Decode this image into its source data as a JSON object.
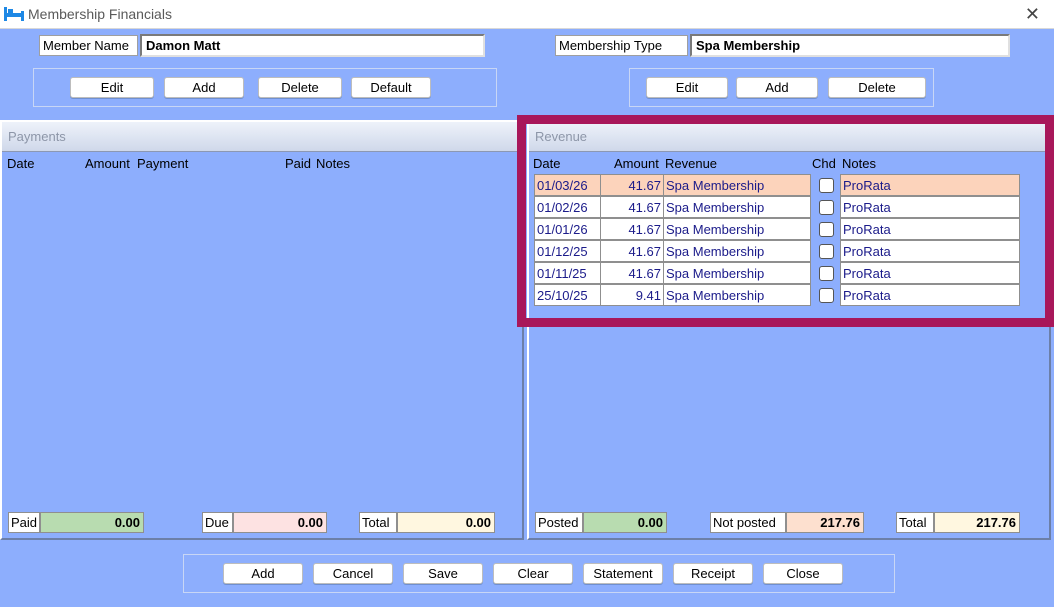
{
  "window": {
    "title": "Membership Financials",
    "close_glyph": "✕"
  },
  "member": {
    "label": "Member Name",
    "value": "Damon Matt"
  },
  "membership_type": {
    "label": "Membership Type",
    "value": "Spa Membership"
  },
  "member_buttons": {
    "edit": "Edit",
    "add": "Add",
    "delete": "Delete",
    "default": "Default"
  },
  "type_buttons": {
    "edit": "Edit",
    "add": "Add",
    "delete": "Delete"
  },
  "payments": {
    "title": "Payments",
    "columns": {
      "date": "Date",
      "amount": "Amount",
      "payment": "Payment",
      "paid": "Paid",
      "notes": "Notes"
    },
    "totals": {
      "paid_label": "Paid",
      "paid_value": "0.00",
      "due_label": "Due",
      "due_value": "0.00",
      "total_label": "Total",
      "total_value": "0.00"
    }
  },
  "revenue": {
    "title": "Revenue",
    "columns": {
      "date": "Date",
      "amount": "Amount",
      "revenue": "Revenue",
      "chd": "Chd",
      "notes": "Notes"
    },
    "rows": [
      {
        "date": "01/03/26",
        "amount": "41.67",
        "revenue": "Spa Membership",
        "chd": false,
        "notes": "ProRata"
      },
      {
        "date": "01/02/26",
        "amount": "41.67",
        "revenue": "Spa Membership",
        "chd": false,
        "notes": "ProRata"
      },
      {
        "date": "01/01/26",
        "amount": "41.67",
        "revenue": "Spa Membership",
        "chd": false,
        "notes": "ProRata"
      },
      {
        "date": "01/12/25",
        "amount": "41.67",
        "revenue": "Spa Membership",
        "chd": false,
        "notes": "ProRata"
      },
      {
        "date": "01/11/25",
        "amount": "41.67",
        "revenue": "Spa Membership",
        "chd": false,
        "notes": "ProRata"
      },
      {
        "date": "25/10/25",
        "amount": "9.41",
        "revenue": "Spa Membership",
        "chd": false,
        "notes": "ProRata"
      }
    ],
    "totals": {
      "posted_label": "Posted",
      "posted_value": "0.00",
      "not_posted_label": "Not posted",
      "not_posted_value": "217.76",
      "total_label": "Total",
      "total_value": "217.76"
    }
  },
  "footer_buttons": {
    "add": "Add",
    "cancel": "Cancel",
    "save": "Save",
    "clear": "Clear",
    "statement": "Statement",
    "receipt": "Receipt",
    "close": "Close"
  },
  "colors": {
    "background": "#8daefd",
    "highlight": "#a8175a",
    "selected_row": "#fcd3bb"
  }
}
